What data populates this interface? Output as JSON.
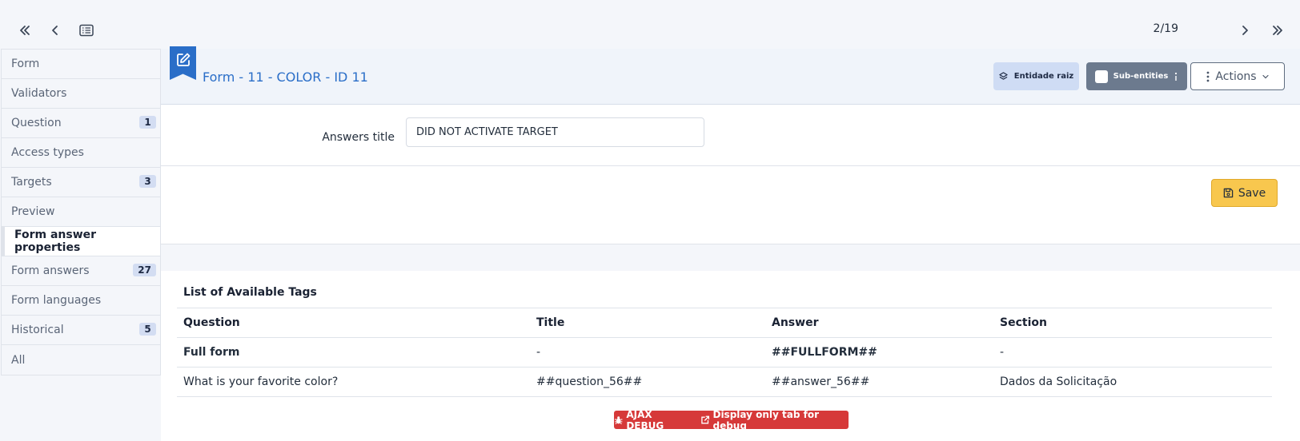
{
  "nav": {
    "counter": "2/19"
  },
  "sidebar": {
    "items": [
      {
        "label": "Form",
        "badge": ""
      },
      {
        "label": "Validators",
        "badge": ""
      },
      {
        "label": "Question",
        "badge": "1"
      },
      {
        "label": "Access types",
        "badge": ""
      },
      {
        "label": "Targets",
        "badge": "3"
      },
      {
        "label": "Preview",
        "badge": ""
      },
      {
        "label": "Form answer properties",
        "badge": "",
        "active": true
      },
      {
        "label": "Form answers",
        "badge": "27"
      },
      {
        "label": "Form languages",
        "badge": ""
      },
      {
        "label": "Historical",
        "badge": "5"
      },
      {
        "label": "All",
        "badge": ""
      }
    ]
  },
  "header": {
    "title": "Form - 11 - COLOR - ID 11",
    "entidade_label": "Entidade raiz",
    "sub_entities_label": "Sub-entities",
    "actions_label": "Actions"
  },
  "form": {
    "answers_title_label": "Answers title",
    "answers_title_value": "DID NOT ACTIVATE TARGET"
  },
  "save_label": "Save",
  "tags": {
    "title": "List of Available Tags",
    "columns": [
      "Question",
      "Title",
      "Answer",
      "Section"
    ],
    "rows": [
      [
        "Full form",
        "-",
        "##FULLFORM##",
        "-"
      ],
      [
        "What is your favorite color?",
        "##question_56##",
        "##answer_56##",
        "Dados da Solicitação"
      ]
    ]
  },
  "debug": {
    "ajax_label": "AJAX DEBUG",
    "display_label": "Display only tab for debug"
  },
  "colors": {
    "accent": "#2a6ec8",
    "save": "#f8c74e",
    "debug": "#d63939",
    "sub_entities": "#6c7a8e"
  }
}
